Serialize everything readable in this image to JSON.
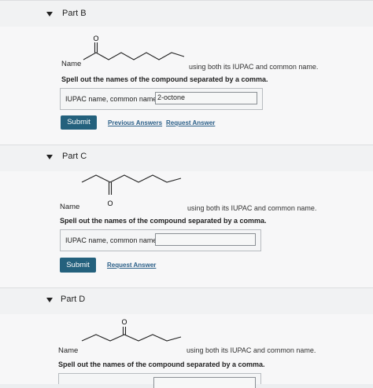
{
  "part_b": {
    "title": "Part B",
    "name_label": "Name",
    "iupac_label": "using both its IUPAC and common name.",
    "instruction": "Spell out the names of the compound separated by a comma.",
    "answer_label": "IUPAC name, common name:",
    "answer_value": "2-octone",
    "submit_label": "Submit",
    "previous_answers_label": "Previous Answers",
    "request_answer_label": "Request Answer",
    "oxygen_label": "O"
  },
  "part_c": {
    "title": "Part C",
    "name_label": "Name",
    "iupac_label": "using both its IUPAC and common name.",
    "instruction": "Spell out the names of the compound separated by a comma.",
    "answer_label": "IUPAC name, common name:",
    "answer_value": "",
    "submit_label": "Submit",
    "request_answer_label": "Request Answer",
    "oxygen_label": "O"
  },
  "part_d": {
    "title": "Part D",
    "name_label": "Name",
    "iupac_label": "using both its IUPAC and common name.",
    "instruction": "Spell out the names of the compound separated by a comma.",
    "oxygen_label": "O"
  }
}
